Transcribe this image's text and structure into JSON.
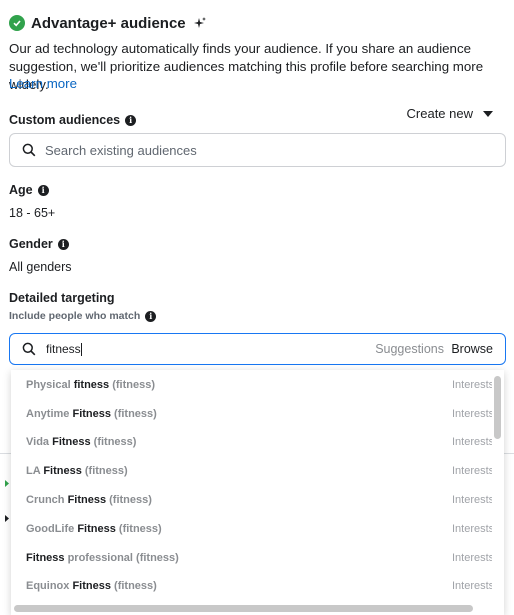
{
  "header": {
    "title": "Advantage+ audience"
  },
  "description": "Our ad technology automatically finds your audience. If you share an audience suggestion, we'll prioritize audiences matching this profile before searching more widely.",
  "learn_more": "Learn more",
  "custom_audiences": {
    "label": "Custom audiences",
    "create_new": "Create new",
    "search_placeholder": "Search existing audiences"
  },
  "age": {
    "label": "Age",
    "value": "18 - 65+"
  },
  "gender": {
    "label": "Gender",
    "value": "All genders"
  },
  "detailed_targeting": {
    "label": "Detailed targeting",
    "sublabel": "Include people who match",
    "query": "fitness",
    "suggestions_tab": "Suggestions",
    "browse_tab": "Browse"
  },
  "results": [
    {
      "prefix": "Physical ",
      "main": "fitness",
      "suffix": "",
      "keyword": "(fitness)",
      "category": "Interests"
    },
    {
      "prefix": "Anytime ",
      "main": "Fitness",
      "suffix": "",
      "keyword": "(fitness)",
      "category": "Interests"
    },
    {
      "prefix": "Vida ",
      "main": "Fitness",
      "suffix": "",
      "keyword": "(fitness)",
      "category": "Interests"
    },
    {
      "prefix": "LA ",
      "main": "Fitness",
      "suffix": "",
      "keyword": "(fitness)",
      "category": "Interests"
    },
    {
      "prefix": "Crunch ",
      "main": "Fitness",
      "suffix": "",
      "keyword": "(fitness)",
      "category": "Interests"
    },
    {
      "prefix": "GoodLife ",
      "main": "Fitness",
      "suffix": "",
      "keyword": "(fitness)",
      "category": "Interests"
    },
    {
      "prefix": "",
      "main": "Fitness",
      "suffix": " professional",
      "keyword": "(fitness)",
      "category": "Interests"
    },
    {
      "prefix": "Equinox ",
      "main": "Fitness",
      "suffix": "",
      "keyword": "(fitness)",
      "category": "Interests"
    }
  ],
  "colors": {
    "accent": "#1877f2",
    "check": "#31a24c",
    "link": "#0a66c2"
  }
}
